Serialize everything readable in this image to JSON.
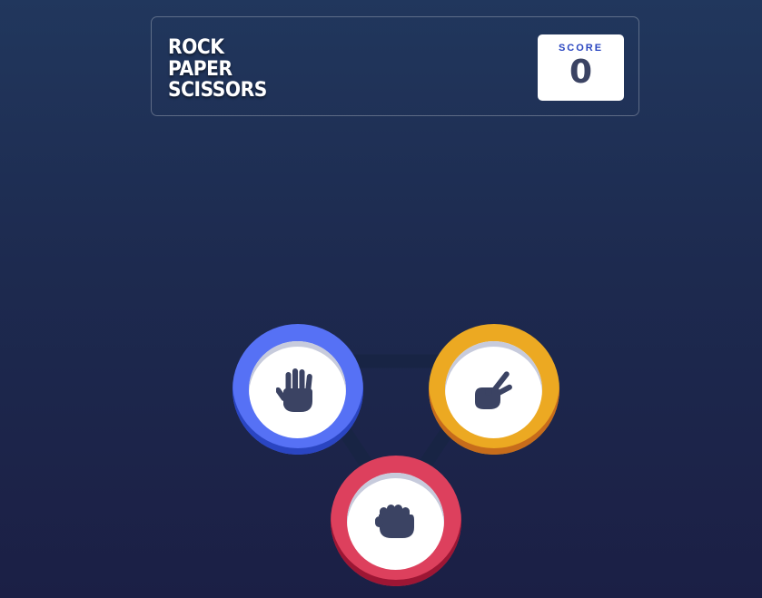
{
  "header": {
    "title_lines": [
      "ROCK",
      "PAPER",
      "SCISSORS"
    ],
    "score_label": "SCORE",
    "score_value": "0"
  },
  "choices": [
    {
      "id": "paper",
      "icon": "paper-hand-icon",
      "ring_color": "#5671f5"
    },
    {
      "id": "scissors",
      "icon": "scissors-hand-icon",
      "ring_color": "#eca922"
    },
    {
      "id": "rock",
      "icon": "rock-fist-icon",
      "ring_color": "#dd405d"
    }
  ],
  "colors": {
    "icon": "#3b4363",
    "background_top": "#21375d",
    "background_bottom": "#1b1f45"
  }
}
